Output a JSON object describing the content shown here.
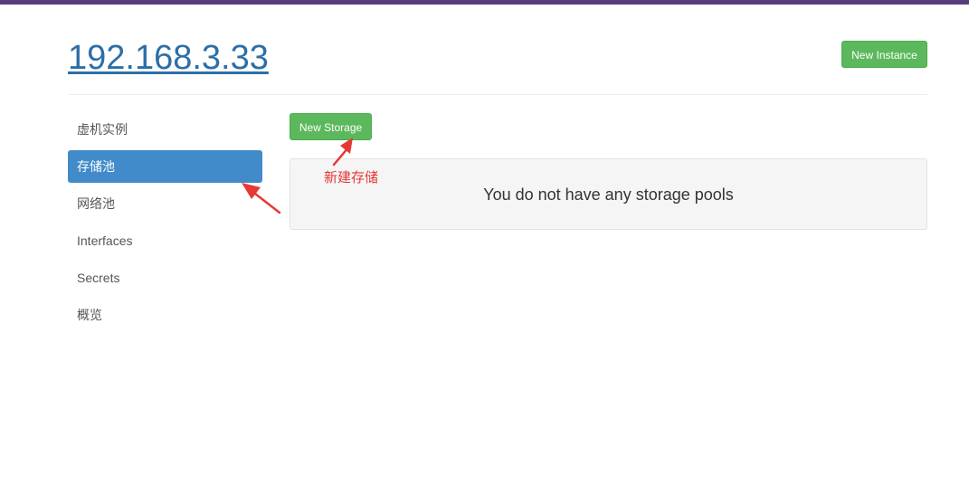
{
  "header": {
    "title": "192.168.3.33",
    "new_instance_label": "New Instance"
  },
  "sidebar": {
    "items": [
      {
        "label": "虚机实例",
        "active": false
      },
      {
        "label": "存储池",
        "active": true
      },
      {
        "label": "网络池",
        "active": false
      },
      {
        "label": "Interfaces",
        "active": false
      },
      {
        "label": "Secrets",
        "active": false
      },
      {
        "label": "概览",
        "active": false
      }
    ]
  },
  "main": {
    "new_storage_label": "New Storage",
    "empty_message": "You do not have any storage pools"
  },
  "annotation": {
    "label": "新建存储",
    "color": "#e53935"
  },
  "colors": {
    "top_bar": "#563d7c",
    "accent_link": "#2c6fa8",
    "success": "#5cb85c",
    "active_nav": "#428bca"
  }
}
